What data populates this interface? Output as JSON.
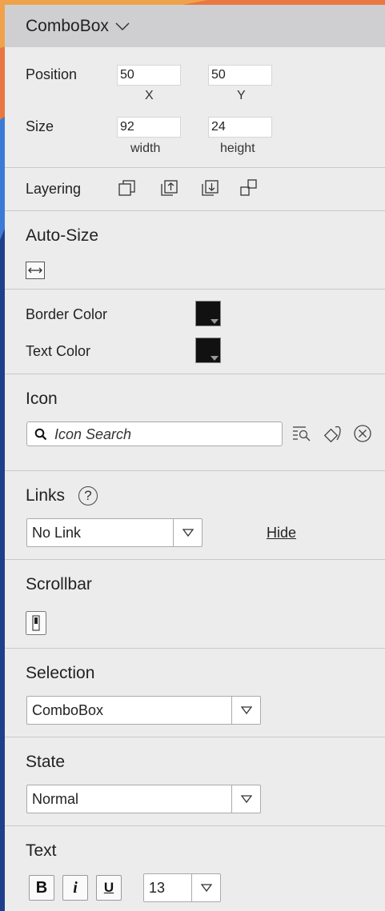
{
  "header": {
    "title": "ComboBox"
  },
  "position": {
    "label": "Position",
    "x_value": "50",
    "y_value": "50",
    "x_caption": "X",
    "y_caption": "Y"
  },
  "size": {
    "label": "Size",
    "width_value": "92",
    "height_value": "24",
    "width_caption": "width",
    "height_caption": "height"
  },
  "layering": {
    "label": "Layering"
  },
  "auto_size": {
    "title": "Auto-Size"
  },
  "colors": {
    "border_label": "Border Color",
    "text_label": "Text Color",
    "border_color": "#111111",
    "text_color": "#111111"
  },
  "icon": {
    "title": "Icon",
    "search_placeholder": "Icon Search"
  },
  "links": {
    "title": "Links",
    "help": "?",
    "selected": "No Link",
    "hide_label": "Hide"
  },
  "scrollbar": {
    "title": "Scrollbar"
  },
  "selection": {
    "title": "Selection",
    "selected": "ComboBox"
  },
  "state": {
    "title": "State",
    "selected": "Normal"
  },
  "text": {
    "title": "Text",
    "bold": "B",
    "italic": "i",
    "underline": "U",
    "font_size": "13"
  }
}
